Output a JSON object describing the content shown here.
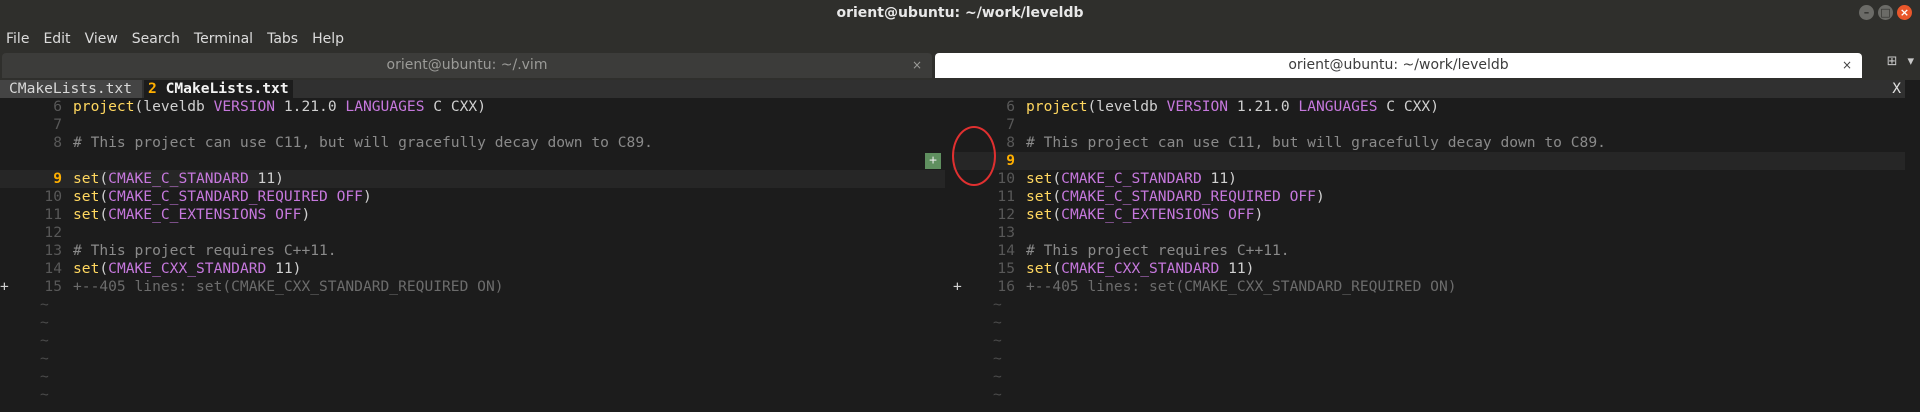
{
  "window": {
    "title": "orient@ubuntu: ~/work/leveldb"
  },
  "menu": [
    "File",
    "Edit",
    "View",
    "Search",
    "Terminal",
    "Tabs",
    "Help"
  ],
  "terminal_tabs": [
    {
      "label": "orient@ubuntu: ~/.vim",
      "close": "×"
    },
    {
      "label": "orient@ubuntu: ~/work/leveldb",
      "close": "×"
    }
  ],
  "vim": {
    "tabline": {
      "tab1": "CMakeLists.txt",
      "tab2_num": "2",
      "tab2_label": "CMakeLists.txt",
      "close": "X"
    },
    "left": {
      "lines": [
        {
          "num": "6",
          "code": [
            [
              "kw",
              "project"
            ],
            [
              "",
              "(leveldb "
            ],
            [
              "str",
              "VERSION"
            ],
            [
              "",
              " 1.21.0 "
            ],
            [
              "str",
              "LANGUAGES"
            ],
            [
              "",
              " C CXX)"
            ]
          ]
        },
        {
          "num": "7",
          "code": []
        },
        {
          "num": "8",
          "code": [
            [
              "cm",
              "# This project can use C11, but will gracefully decay down to C89."
            ]
          ]
        },
        {
          "num": "",
          "deleted": true,
          "code": [
            [
              "",
              "--------------------------------------------------------------------------------------------------------------"
            ]
          ]
        },
        {
          "num": "9",
          "current": true,
          "code": [
            [
              "kw",
              "set"
            ],
            [
              "",
              "("
            ],
            [
              "str",
              "CMAKE_C_STANDARD"
            ],
            [
              "",
              " 11)"
            ]
          ]
        },
        {
          "num": "10",
          "code": [
            [
              "kw",
              "set"
            ],
            [
              "",
              "("
            ],
            [
              "str",
              "CMAKE_C_STANDARD_REQUIRED"
            ],
            [
              "",
              " "
            ],
            [
              "str",
              "OFF"
            ],
            [
              "",
              ")"
            ]
          ]
        },
        {
          "num": "11",
          "code": [
            [
              "kw",
              "set"
            ],
            [
              "",
              "("
            ],
            [
              "str",
              "CMAKE_C_EXTENSIONS"
            ],
            [
              "",
              " "
            ],
            [
              "str",
              "OFF"
            ],
            [
              "",
              ")"
            ]
          ]
        },
        {
          "num": "12",
          "code": []
        },
        {
          "num": "13",
          "code": [
            [
              "cm",
              "# This project requires C++11."
            ]
          ]
        },
        {
          "num": "14",
          "code": [
            [
              "kw",
              "set"
            ],
            [
              "",
              "("
            ],
            [
              "str",
              "CMAKE_CXX_STANDARD"
            ],
            [
              "",
              " 11)"
            ]
          ]
        },
        {
          "num": "15",
          "sign": "+",
          "code": [
            [
              "fold",
              "+--405 lines: set(CMAKE_CXX_STANDARD_REQUIRED ON)"
            ]
          ]
        }
      ]
    },
    "right": {
      "lines": [
        {
          "num": "6",
          "code": [
            [
              "kw",
              "project"
            ],
            [
              "",
              "(leveldb "
            ],
            [
              "str",
              "VERSION"
            ],
            [
              "",
              " 1.21.0 "
            ],
            [
              "str",
              "LANGUAGES"
            ],
            [
              "",
              " C CXX)"
            ]
          ]
        },
        {
          "num": "7",
          "code": []
        },
        {
          "num": "8",
          "code": [
            [
              "cm",
              "# This project can use C11, but will gracefully decay down to C89."
            ]
          ]
        },
        {
          "num": "9",
          "current": true,
          "added_mark": "+",
          "code": []
        },
        {
          "num": "10",
          "code": [
            [
              "kw",
              "set"
            ],
            [
              "",
              "("
            ],
            [
              "str",
              "CMAKE_C_STANDARD"
            ],
            [
              "",
              " 11)"
            ]
          ]
        },
        {
          "num": "11",
          "code": [
            [
              "kw",
              "set"
            ],
            [
              "",
              "("
            ],
            [
              "str",
              "CMAKE_C_STANDARD_REQUIRED"
            ],
            [
              "",
              " "
            ],
            [
              "str",
              "OFF"
            ],
            [
              "",
              ")"
            ]
          ]
        },
        {
          "num": "12",
          "code": [
            [
              "kw",
              "set"
            ],
            [
              "",
              "("
            ],
            [
              "str",
              "CMAKE_C_EXTENSIONS"
            ],
            [
              "",
              " "
            ],
            [
              "str",
              "OFF"
            ],
            [
              "",
              ")"
            ]
          ]
        },
        {
          "num": "13",
          "code": []
        },
        {
          "num": "14",
          "code": [
            [
              "cm",
              "# This project requires C++11."
            ]
          ]
        },
        {
          "num": "15",
          "code": [
            [
              "kw",
              "set"
            ],
            [
              "",
              "("
            ],
            [
              "str",
              "CMAKE_CXX_STANDARD"
            ],
            [
              "",
              " 11)"
            ]
          ]
        },
        {
          "num": "16",
          "sign": "+",
          "code": [
            [
              "fold",
              "+--405 lines: set(CMAKE_CXX_STANDARD_REQUIRED ON)"
            ]
          ]
        }
      ]
    },
    "tilde": "~",
    "tilde_count": 6
  }
}
